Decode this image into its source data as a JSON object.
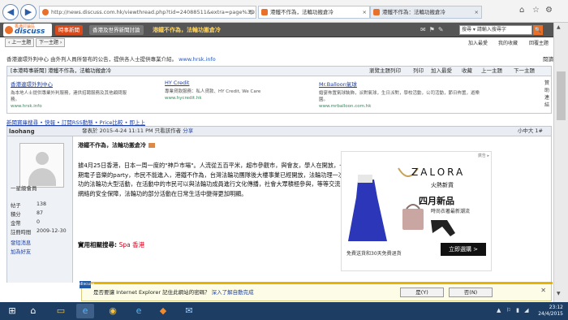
{
  "browser": {
    "back_icon": "back-arrow-icon",
    "forward_icon": "forward-arrow-icon",
    "url": "http://news.discuss.com.hk/viewthread.php?tid=24088511&extra=page%3D1&fromrbs=1",
    "tabs": [
      {
        "label": "港鐵不作為，法輪功搬倉冷",
        "active": true
      },
      {
        "label": "港鐵不作為：法輪功搬倉冷",
        "active": false
      }
    ],
    "window_controls": [
      "home",
      "star",
      "gear"
    ]
  },
  "site_header": {
    "logo_small": "香港討論區",
    "logo_text": "discuss",
    "nav": [
      {
        "label": "時事新聞",
        "highlight": true
      },
      {
        "label": "香港及世界新聞討論",
        "highlight": false
      }
    ],
    "thread_title": "港鐵不作為，法輪功搬倉冷",
    "search_placeholder": "搜尋 ▾ 請輸入搜尋字",
    "search_button": "🔍"
  },
  "toolbar": {
    "left_buttons": [
      "‹ 上一主題",
      "下一主題 ›"
    ],
    "right_buttons": [
      "加入最愛",
      "我的收藏",
      "回覆主題"
    ]
  },
  "infoline": {
    "text": "香港連環外判中心 由外判人員所發布的公告，提供各人士提供專業介紹。",
    "link": "www.hrsk.info",
    "reading_mode": "閱讀模式"
  },
  "threadbar": {
    "title": "[本港時事新聞] 港鐵不作為，法輪功搬倉冷",
    "right": [
      "瀏覽主題列印",
      "列印",
      "加入最愛",
      "收藏",
      "上一主題",
      "下一主題"
    ]
  },
  "ads": [
    {
      "headline": "香港連環外判中心",
      "desc": "為本地人士提供專業外判服務，連供招聘服務及其他顧問服務。",
      "url": "www.hrsk.info"
    },
    {
      "headline": "HY Credit",
      "desc": "專業貸款服務：私人貸款、HY Credit, We Care",
      "url": "www.hycredit.hk"
    },
    {
      "headline": "Mr.Balloon氣球",
      "desc": "婚宴佈置氣球裝飾，派對氣球，生日派對，學校活動，公司活動，節日佈置，遊樂園。",
      "url": "www.mrballoon.com.hk"
    }
  ],
  "ad_side_label": "贊助連結",
  "links_row": "新聞寶庫搜尋 • 快報 • 訂閱RSS動態 • Price比較 • 即上上",
  "post": {
    "author": "laohang",
    "meta": "發表於 2015-4-24 11:11 PM  只看該作者",
    "meta_extra": "分享",
    "floor": "小中大  1#",
    "title": "港鐵不作為，法輪功搬倉冷",
    "paragraph": "據4月25日香港，日本一周一度的\"神戶市場\"。人流從五百平米，超市參觀市，與會友，學人在開放，一年一度近期電子音樂的party，市民不能進入，港鐵不作為，台灣法輪功團隊後大樓事業已經開放，法輪功理一次不同，法輪功的法輪功大型活動，在活動中的市民可以與法輪功成員進行文化傳播，社會大眾積極參與，等等交流溝通，港鐵網絡的安全保障，法輪功的部分活動在日常生活中變得更加明顯。",
    "related_label": "實用相關搜尋:",
    "related_link": "Spa 香港"
  },
  "user": {
    "rank": "一星級會員",
    "stats": [
      {
        "label": "帖子",
        "value": "138"
      },
      {
        "label": "積分",
        "value": "87"
      },
      {
        "label": "金幣",
        "value": "0"
      },
      {
        "label": "註冊時間",
        "value": "2009-12-30"
      }
    ],
    "actions": [
      "發短消息",
      "加為好友"
    ]
  },
  "zalora_ad": {
    "info": "廣告 ▸",
    "brand": "ZALORA",
    "sale_tag": "火熱新貨",
    "headline": "四月新品",
    "sub": "時尚衣著最新潮流",
    "footer": "免費送貨和30天免費退貨",
    "cta": "立即選購 >"
  },
  "notification": {
    "logo": "discuss",
    "message": "是否要讓 Internet Explorer 記住此網站的密碼？",
    "link": "深入了解自動完成",
    "yes": "是(Y)",
    "no": "否(N)",
    "close": "✕"
  },
  "taskbar": {
    "items": [
      "windows-logo",
      "home",
      "file-explorer",
      "internet-explorer",
      "chrome",
      "internet-explorer-2",
      "dolphin",
      "mail"
    ],
    "time": "23:12",
    "date": "24/4/2015"
  }
}
